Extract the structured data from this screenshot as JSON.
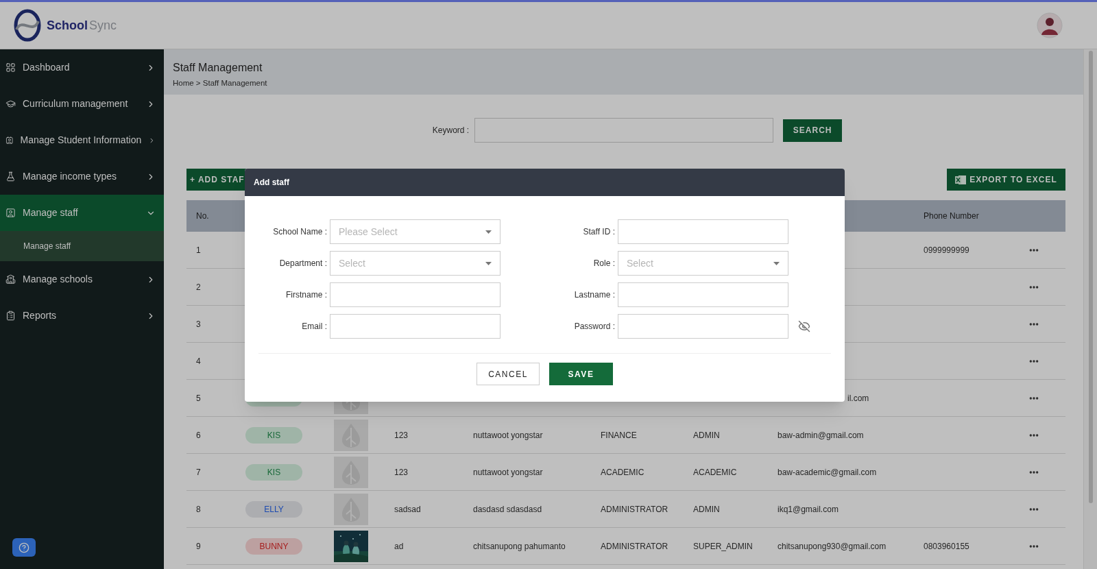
{
  "header": {
    "logo": {
      "first": "School",
      "second": "Sync"
    }
  },
  "sidebar": {
    "items": [
      {
        "label": "Dashboard",
        "expanded": false,
        "selected": false
      },
      {
        "label": "Curriculum management",
        "expanded": false,
        "selected": false
      },
      {
        "label": "Manage Student Information",
        "expanded": false,
        "selected": false
      },
      {
        "label": "Manage income types",
        "expanded": false,
        "selected": false
      },
      {
        "label": "Manage staff",
        "expanded": true,
        "selected": true,
        "children": [
          {
            "label": "Manage staff",
            "selected": true
          }
        ]
      },
      {
        "label": "Manage schools",
        "expanded": false,
        "selected": false
      },
      {
        "label": "Reports",
        "expanded": false,
        "selected": false
      }
    ]
  },
  "page": {
    "title": "Staff Management",
    "breadcrumb": "Home > Staff Management"
  },
  "search": {
    "label": "Keyword :",
    "button": "SEARCH"
  },
  "actions": {
    "add": "+ ADD STAF",
    "export": "EXPORT TO EXCEL"
  },
  "table": {
    "columns": {
      "no": "No.",
      "phone": "Phone Number"
    },
    "rows": [
      {
        "no": "1",
        "phone": "0999999999"
      },
      {
        "no": "2"
      },
      {
        "no": "3"
      },
      {
        "no": "4"
      },
      {
        "no": "5",
        "badge": {
          "color": "#9fb4a7"
        },
        "photo": {
          "kind": "placeholder"
        },
        "email": "il.com"
      },
      {
        "no": "6",
        "badge": {
          "text": "KIS",
          "color": "#9fb4a7"
        },
        "photo": {
          "kind": "placeholder"
        },
        "staff_id": "123",
        "name": "nuttawoot yongstar",
        "department": "FINANCE",
        "role": "ADMIN",
        "email": "baw-admin@gmail.com"
      },
      {
        "no": "7",
        "badge": {
          "text": "KIS",
          "color": "#9fb4a7"
        },
        "photo": {
          "kind": "placeholder"
        },
        "staff_id": "123",
        "name": "nuttawoot yongstar",
        "department": "ACADEMIC",
        "role": "ACADEMIC",
        "email": "baw-academic@gmail.com"
      },
      {
        "no": "8",
        "badge": {
          "text": "ELLY",
          "color": "#acadb0"
        },
        "photo": {
          "kind": "placeholder"
        },
        "staff_id": "sadsad",
        "name": "dasdasd sdasdasd",
        "department": "ADMINISTRATOR",
        "role": "ADMIN",
        "email": "ikq1@gmail.com"
      },
      {
        "no": "9",
        "badge": {
          "text": "BUNNY",
          "color": "#bca0a0"
        },
        "staff_id": "ad",
        "name": "chitsanupong pahumanto",
        "department": "ADMINISTRATOR",
        "role": "SUPER_ADMIN",
        "email": "chitsanupong930@gmail.com",
        "phone": "0803960155"
      }
    ]
  },
  "modal": {
    "title": "Add staff",
    "fields": [
      {
        "label": "School Name :",
        "kind": "select",
        "placeholder": "Please Select"
      },
      {
        "label": "Staff ID :",
        "kind": "text"
      },
      {
        "label": "Department :",
        "kind": "select",
        "placeholder": "Select"
      },
      {
        "label": "Role :",
        "kind": "select",
        "placeholder": "Select"
      },
      {
        "label": "Firstname :",
        "kind": "text"
      },
      {
        "label": "Lastname :",
        "kind": "text"
      },
      {
        "label": "Email :",
        "kind": "text"
      },
      {
        "label": "Password :",
        "kind": "password"
      }
    ],
    "buttons": {
      "cancel": "CANCEL",
      "save": "SAVE"
    }
  }
}
